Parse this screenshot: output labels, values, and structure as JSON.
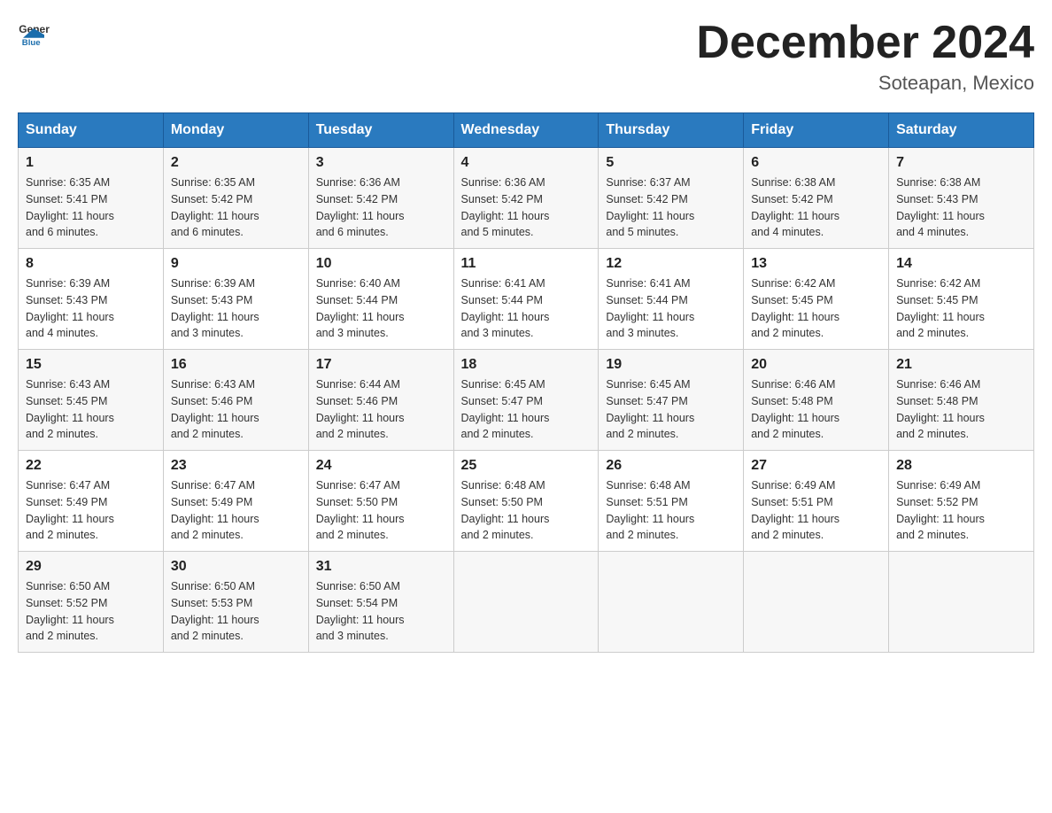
{
  "header": {
    "logo_text_general": "General",
    "logo_text_blue": "Blue",
    "month_title": "December 2024",
    "location": "Soteapan, Mexico"
  },
  "days_of_week": [
    "Sunday",
    "Monday",
    "Tuesday",
    "Wednesday",
    "Thursday",
    "Friday",
    "Saturday"
  ],
  "weeks": [
    [
      {
        "num": "1",
        "sunrise": "6:35 AM",
        "sunset": "5:41 PM",
        "daylight": "11 hours and 6 minutes."
      },
      {
        "num": "2",
        "sunrise": "6:35 AM",
        "sunset": "5:42 PM",
        "daylight": "11 hours and 6 minutes."
      },
      {
        "num": "3",
        "sunrise": "6:36 AM",
        "sunset": "5:42 PM",
        "daylight": "11 hours and 6 minutes."
      },
      {
        "num": "4",
        "sunrise": "6:36 AM",
        "sunset": "5:42 PM",
        "daylight": "11 hours and 5 minutes."
      },
      {
        "num": "5",
        "sunrise": "6:37 AM",
        "sunset": "5:42 PM",
        "daylight": "11 hours and 5 minutes."
      },
      {
        "num": "6",
        "sunrise": "6:38 AM",
        "sunset": "5:42 PM",
        "daylight": "11 hours and 4 minutes."
      },
      {
        "num": "7",
        "sunrise": "6:38 AM",
        "sunset": "5:43 PM",
        "daylight": "11 hours and 4 minutes."
      }
    ],
    [
      {
        "num": "8",
        "sunrise": "6:39 AM",
        "sunset": "5:43 PM",
        "daylight": "11 hours and 4 minutes."
      },
      {
        "num": "9",
        "sunrise": "6:39 AM",
        "sunset": "5:43 PM",
        "daylight": "11 hours and 3 minutes."
      },
      {
        "num": "10",
        "sunrise": "6:40 AM",
        "sunset": "5:44 PM",
        "daylight": "11 hours and 3 minutes."
      },
      {
        "num": "11",
        "sunrise": "6:41 AM",
        "sunset": "5:44 PM",
        "daylight": "11 hours and 3 minutes."
      },
      {
        "num": "12",
        "sunrise": "6:41 AM",
        "sunset": "5:44 PM",
        "daylight": "11 hours and 3 minutes."
      },
      {
        "num": "13",
        "sunrise": "6:42 AM",
        "sunset": "5:45 PM",
        "daylight": "11 hours and 2 minutes."
      },
      {
        "num": "14",
        "sunrise": "6:42 AM",
        "sunset": "5:45 PM",
        "daylight": "11 hours and 2 minutes."
      }
    ],
    [
      {
        "num": "15",
        "sunrise": "6:43 AM",
        "sunset": "5:45 PM",
        "daylight": "11 hours and 2 minutes."
      },
      {
        "num": "16",
        "sunrise": "6:43 AM",
        "sunset": "5:46 PM",
        "daylight": "11 hours and 2 minutes."
      },
      {
        "num": "17",
        "sunrise": "6:44 AM",
        "sunset": "5:46 PM",
        "daylight": "11 hours and 2 minutes."
      },
      {
        "num": "18",
        "sunrise": "6:45 AM",
        "sunset": "5:47 PM",
        "daylight": "11 hours and 2 minutes."
      },
      {
        "num": "19",
        "sunrise": "6:45 AM",
        "sunset": "5:47 PM",
        "daylight": "11 hours and 2 minutes."
      },
      {
        "num": "20",
        "sunrise": "6:46 AM",
        "sunset": "5:48 PM",
        "daylight": "11 hours and 2 minutes."
      },
      {
        "num": "21",
        "sunrise": "6:46 AM",
        "sunset": "5:48 PM",
        "daylight": "11 hours and 2 minutes."
      }
    ],
    [
      {
        "num": "22",
        "sunrise": "6:47 AM",
        "sunset": "5:49 PM",
        "daylight": "11 hours and 2 minutes."
      },
      {
        "num": "23",
        "sunrise": "6:47 AM",
        "sunset": "5:49 PM",
        "daylight": "11 hours and 2 minutes."
      },
      {
        "num": "24",
        "sunrise": "6:47 AM",
        "sunset": "5:50 PM",
        "daylight": "11 hours and 2 minutes."
      },
      {
        "num": "25",
        "sunrise": "6:48 AM",
        "sunset": "5:50 PM",
        "daylight": "11 hours and 2 minutes."
      },
      {
        "num": "26",
        "sunrise": "6:48 AM",
        "sunset": "5:51 PM",
        "daylight": "11 hours and 2 minutes."
      },
      {
        "num": "27",
        "sunrise": "6:49 AM",
        "sunset": "5:51 PM",
        "daylight": "11 hours and 2 minutes."
      },
      {
        "num": "28",
        "sunrise": "6:49 AM",
        "sunset": "5:52 PM",
        "daylight": "11 hours and 2 minutes."
      }
    ],
    [
      {
        "num": "29",
        "sunrise": "6:50 AM",
        "sunset": "5:52 PM",
        "daylight": "11 hours and 2 minutes."
      },
      {
        "num": "30",
        "sunrise": "6:50 AM",
        "sunset": "5:53 PM",
        "daylight": "11 hours and 2 minutes."
      },
      {
        "num": "31",
        "sunrise": "6:50 AM",
        "sunset": "5:54 PM",
        "daylight": "11 hours and 3 minutes."
      },
      null,
      null,
      null,
      null
    ]
  ],
  "labels": {
    "sunrise": "Sunrise:",
    "sunset": "Sunset:",
    "daylight": "Daylight:"
  }
}
